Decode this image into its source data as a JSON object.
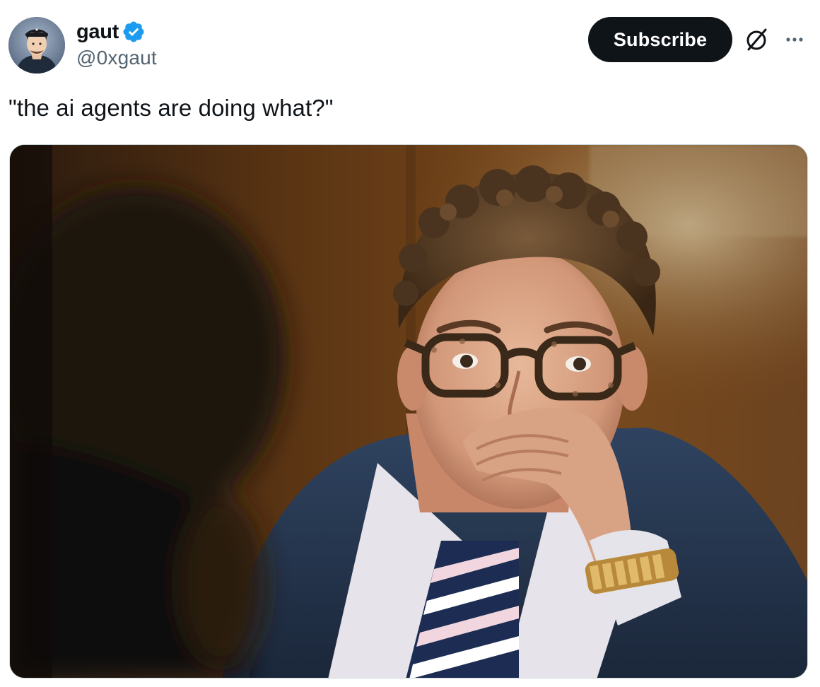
{
  "author": {
    "display_name": "gaut",
    "handle": "@0xgaut",
    "verified": true,
    "verified_color": "#1d9bf0"
  },
  "actions": {
    "subscribe_label": "Subscribe",
    "grok_icon": "grok-icon",
    "more_icon": "more-options-icon"
  },
  "tweet": {
    "text": "\"the ai agents are doing what?\""
  },
  "colors": {
    "text_primary": "#0f1419",
    "text_secondary": "#536471",
    "button_bg": "#0f1419",
    "button_text": "#ffffff",
    "border": "#cfd9de"
  }
}
